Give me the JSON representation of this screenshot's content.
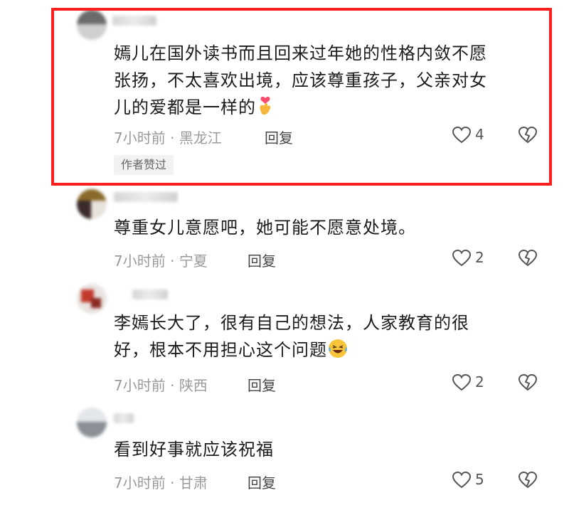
{
  "comments": [
    {
      "text_lines": [
        "嫣儿在国外读书而且回来过年她的性格内敛不愿",
        "张扬，不太喜欢出境，应该尊重孩子，父亲对女",
        "儿的爱都是一样的"
      ],
      "emoji": "finger-heart-emoji",
      "time": "7小时前",
      "location": "黑龙江",
      "reply_label": "回复",
      "likes": "4",
      "badge": "作者赞过"
    },
    {
      "text_lines": [
        "尊重女儿意愿吧，她可能不愿意处境。"
      ],
      "time": "7小时前",
      "location": "宁夏",
      "reply_label": "回复",
      "likes": "2"
    },
    {
      "text_lines": [
        "李嫣长大了，很有自己的想法，人家教育的很",
        "好，根本不用担心这个问题"
      ],
      "emoji": "laughing-tears-emoji",
      "time": "7小时前",
      "location": "陕西",
      "reply_label": "回复",
      "likes": "2"
    },
    {
      "text_lines": [
        "看到好事就应该祝福"
      ],
      "time": "7小时前",
      "location": "甘肃",
      "reply_label": "回复",
      "likes": "5"
    }
  ],
  "meta_separator": " · ",
  "colors": {
    "highlight_border": "#ff1f1f",
    "meta_text": "#9a9a9a",
    "badge_bg": "#f2f2f2"
  }
}
